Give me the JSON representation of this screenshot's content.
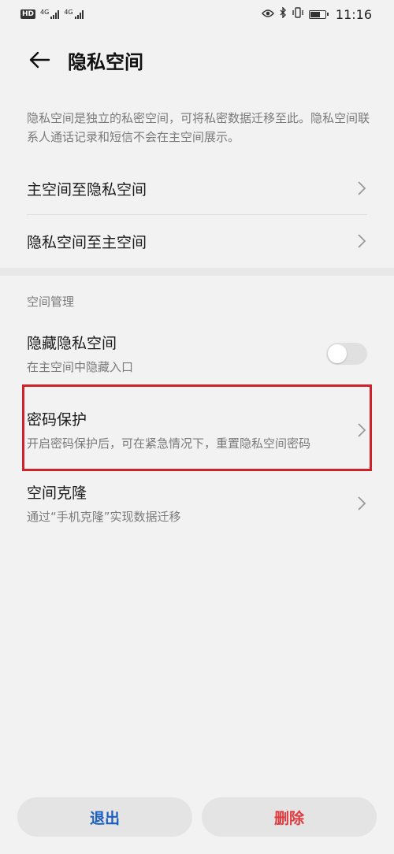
{
  "status_bar": {
    "hd_label": "HD",
    "signal1_label": "4G",
    "signal2_label": "4G",
    "time": "11:16"
  },
  "header": {
    "title": "隐私空间"
  },
  "description": "隐私空间是独立的私密空间，可将私密数据迁移至此。隐私空间联系人通话记录和短信不会在主空间展示。",
  "nav_items": [
    {
      "label": "主空间至隐私空间"
    },
    {
      "label": "隐私空间至主空间"
    }
  ],
  "management": {
    "section_title": "空间管理",
    "hide_space": {
      "label": "隐藏隐私空间",
      "sub": "在主空间中隐藏入口",
      "enabled": false
    },
    "password_protect": {
      "label": "密码保护",
      "sub": "开启密码保护后，可在紧急情况下，重置隐私空间密码"
    },
    "space_clone": {
      "label": "空间克隆",
      "sub": "通过“手机克隆”实现数据迁移"
    }
  },
  "bottom": {
    "exit_label": "退出",
    "delete_label": "删除"
  },
  "colors": {
    "accent_blue": "#1a5fbf",
    "danger_red": "#e0393e",
    "highlight_red": "#d0202a"
  }
}
